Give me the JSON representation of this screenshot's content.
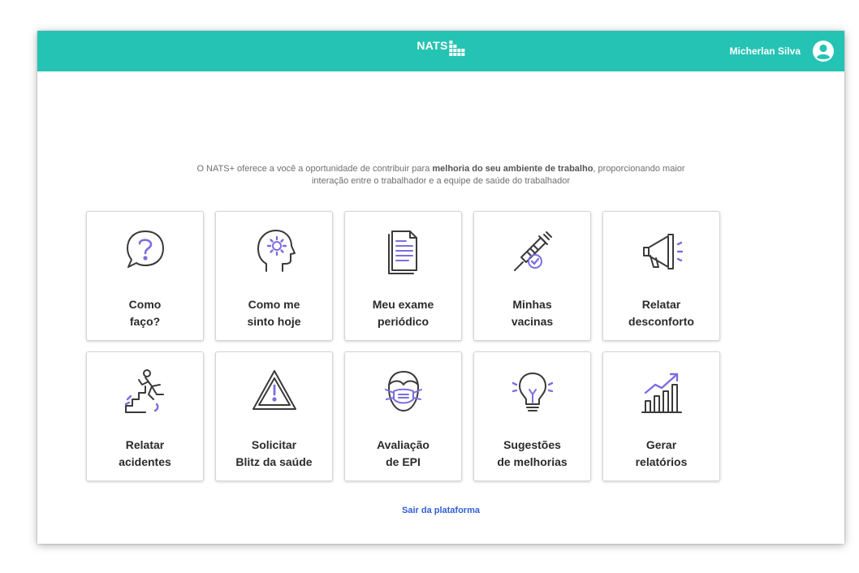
{
  "header": {
    "logo_text": "NATS",
    "user_name": "Micherlan Silva"
  },
  "intro": {
    "before": "O NATS+ oferece a você a oportunidade de contribuir para ",
    "bold": "melhoria do seu ambiente de trabalho",
    "after": ", proporcionando maior",
    "line2": "interação entre o trabalhador e a equipe de saúde do trabalhador"
  },
  "cards": [
    {
      "line1": "Como",
      "line2": "faço?",
      "icon": "question-bubble-icon"
    },
    {
      "line1": "Como me",
      "line2": "sinto hoje",
      "icon": "head-gear-icon"
    },
    {
      "line1": "Meu exame",
      "line2": "periódico",
      "icon": "document-icon"
    },
    {
      "line1": "Minhas",
      "line2": "vacinas",
      "icon": "syringe-icon"
    },
    {
      "line1": "Relatar",
      "line2": "desconforto",
      "icon": "megaphone-icon"
    },
    {
      "line1": "Relatar",
      "line2": "acidentes",
      "icon": "falling-person-icon"
    },
    {
      "line1": "Solicitar",
      "line2": "Blitz da saúde",
      "icon": "warning-triangle-icon"
    },
    {
      "line1": "Avaliação",
      "line2": "de EPI",
      "icon": "face-mask-icon"
    },
    {
      "line1": "Sugestões",
      "line2": "de melhorias",
      "icon": "lightbulb-icon"
    },
    {
      "line1": "Gerar",
      "line2": "relatórios",
      "icon": "bar-chart-icon"
    }
  ],
  "logout_label": "Sair da plataforma",
  "colors": {
    "topbar": "#25c3b4",
    "icon_stroke": "#3a3a3a",
    "icon_accent": "#7b6fe0",
    "link": "#2f5fd6"
  }
}
